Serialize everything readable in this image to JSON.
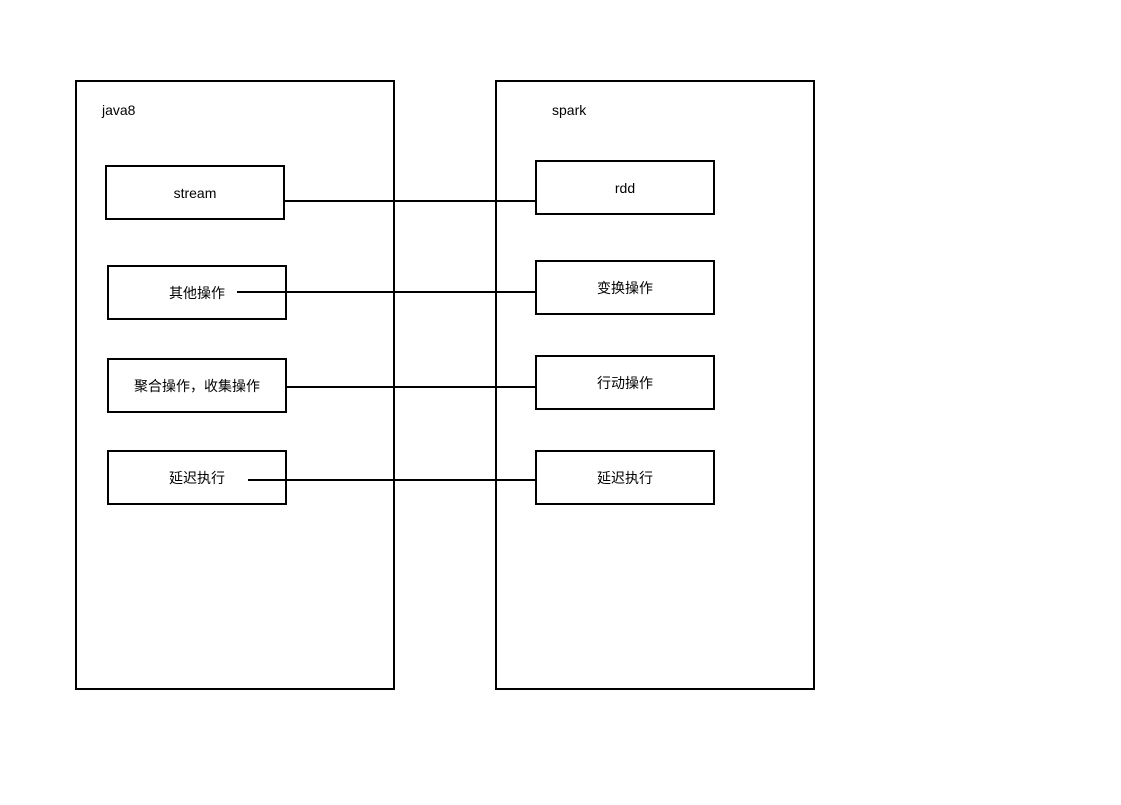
{
  "left": {
    "title": "java8",
    "boxes": [
      {
        "label": "stream"
      },
      {
        "label": "其他操作"
      },
      {
        "label": "聚合操作，收集操作"
      },
      {
        "label": "延迟执行"
      }
    ]
  },
  "right": {
    "title": "spark",
    "boxes": [
      {
        "label": "rdd"
      },
      {
        "label": "变换操作"
      },
      {
        "label": "行动操作"
      },
      {
        "label": "延迟执行"
      }
    ]
  }
}
